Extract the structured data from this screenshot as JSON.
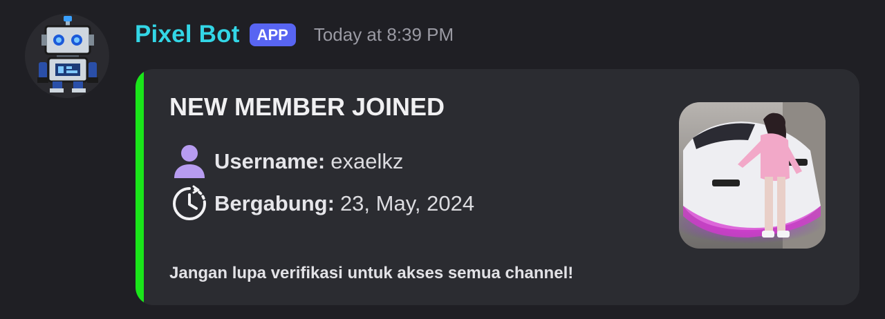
{
  "message": {
    "author": "Pixel Bot",
    "badge": "APP",
    "timestamp": "Today at 8:39 PM",
    "colors": {
      "author": "#33d6e6",
      "badge": "#5865f2",
      "embed_accent": "#1ae51a"
    }
  },
  "embed": {
    "title": "NEW MEMBER JOINED",
    "fields": [
      {
        "icon": "user-icon",
        "label": "Username:",
        "value": "exaelkz"
      },
      {
        "icon": "clock-history-icon",
        "label": "Bergabung:",
        "value": "23, May, 2024"
      }
    ],
    "footer": "Jangan lupa verifikasi untuk akses semua channel!",
    "thumbnail": "member-avatar-image"
  },
  "avatar": "robot-avatar"
}
